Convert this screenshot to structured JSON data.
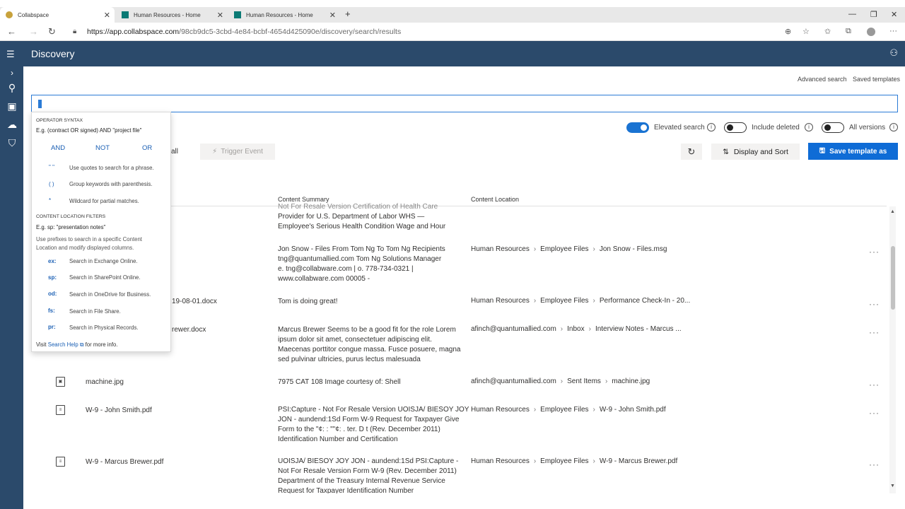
{
  "browser": {
    "tabs": [
      {
        "title": "Collabspace",
        "active": true
      },
      {
        "title": "Human Resources - Home",
        "active": false
      },
      {
        "title": "Human Resources - Home",
        "active": false
      }
    ],
    "url_host": "https://app.collabspace.com",
    "url_path": "/98cb9dc5-3cbd-4e84-bcbf-4654d425090e/discovery/search/results"
  },
  "app": {
    "title": "Discovery",
    "advanced_search": "Advanced search",
    "saved_templates": "Saved templates"
  },
  "toggles": {
    "elevated": {
      "label": "Elevated search",
      "on": true
    },
    "deleted": {
      "label": "Include deleted",
      "on": false
    },
    "versions": {
      "label": "All versions",
      "on": false
    }
  },
  "actions": {
    "partial": "all",
    "trigger": "Trigger Event",
    "display_sort": "Display and Sort",
    "save_template": "Save template as"
  },
  "table": {
    "col_summary": "Content Summary",
    "col_location": "Content Location",
    "rows": [
      {
        "name": "",
        "summary": [
          "Not For Resale Version Certification of Health Care",
          "Provider for U.S. Department of Labor WHS —",
          "Employee's Serious Health Condition Wage and Hour"
        ],
        "location": []
      },
      {
        "name": "",
        "summary": [
          "Jon Snow - Files From Tom Ng To Tom Ng Recipients",
          "tng@quantumallied.com    Tom Ng Solutions Manager",
          "e. tng@collabware.com | o. 778-734-0321  |",
          "www.collabware.com   00005 -"
        ],
        "location": [
          "Human Resources",
          "Employee Files",
          "Jon Snow - Files.msg"
        ]
      },
      {
        "name": "19-08-01.docx",
        "summary": [
          "Tom is doing great!"
        ],
        "location": [
          "Human Resources",
          "Employee Files",
          "Performance Check-In - 20..."
        ]
      },
      {
        "name": "rewer.docx",
        "summary": [
          "Marcus Brewer Seems to be a good fit for the role Lorem",
          "ipsum dolor sit amet, consectetuer adipiscing elit.",
          "Maecenas porttitor congue massa. Fusce posuere, magna",
          "sed pulvinar ultricies, purus lectus malesuada"
        ],
        "location": [
          "afinch@quantumallied.com",
          "Inbox",
          "Interview Notes - Marcus ..."
        ]
      },
      {
        "name": "machine.jpg",
        "summary": [
          "7975 CAT 108 Image courtesy of: Shell"
        ],
        "location": [
          "afinch@quantumallied.com",
          "Sent Items",
          "machine.jpg"
        ]
      },
      {
        "name": "W-9 - John Smith.pdf",
        "summary": [
          "PSI:Capture - Not For Resale Version UOISJA/ BIESOY JOY",
          "JON - aundend:1Sd Form W-9 Request for Taxpayer Give",
          "Form to the \"¢: : \"\"¢: . ter. D t (Rev. December 2011)",
          "Identification Number and Certification"
        ],
        "location": [
          "Human Resources",
          "Employee Files",
          "W-9 - John Smith.pdf"
        ]
      },
      {
        "name": "W-9 - Marcus Brewer.pdf",
        "summary": [
          "UOISJA/ BIESOY JOY JON - aundend:1Sd PSI:Capture -",
          "Not For Resale Version Form W-9 (Rev. December 2011)",
          "Department of the Treasury Internal Revenue Service",
          "Request for Taxpayer Identification Number"
        ],
        "location": [
          "Human Resources",
          "Employee Files",
          "W-9 - Marcus Brewer.pdf"
        ]
      }
    ]
  },
  "help": {
    "op_title": "OPERATOR SYNTAX",
    "op_example": "E.g. (contract OR signed) AND \"project file\"",
    "ops": [
      "AND",
      "NOT",
      "OR"
    ],
    "syntax": [
      {
        "sym": "\" \"",
        "desc": "Use quotes to search for a phrase."
      },
      {
        "sym": "( )",
        "desc": "Group keywords with parenthesis."
      },
      {
        "sym": "*",
        "desc": "Wildcard for partial matches."
      }
    ],
    "loc_title": "CONTENT LOCATION FILTERS",
    "loc_example": "E.g. sp: \"presentation notes\"",
    "loc_text": "Use prefixes to search in a specific Content Location and modify displayed columns.",
    "prefixes": [
      {
        "pre": "ex:",
        "desc": "Search in Exchange Online."
      },
      {
        "pre": "sp:",
        "desc": "Search in SharePoint Online."
      },
      {
        "pre": "od:",
        "desc": "Search in OneDrive for Business."
      },
      {
        "pre": "fs:",
        "desc": "Search in File Share."
      },
      {
        "pre": "pr:",
        "desc": "Search in Physical Records."
      }
    ],
    "foot_visit": "Visit",
    "foot_link": "Search Help",
    "foot_more": "for more info."
  }
}
